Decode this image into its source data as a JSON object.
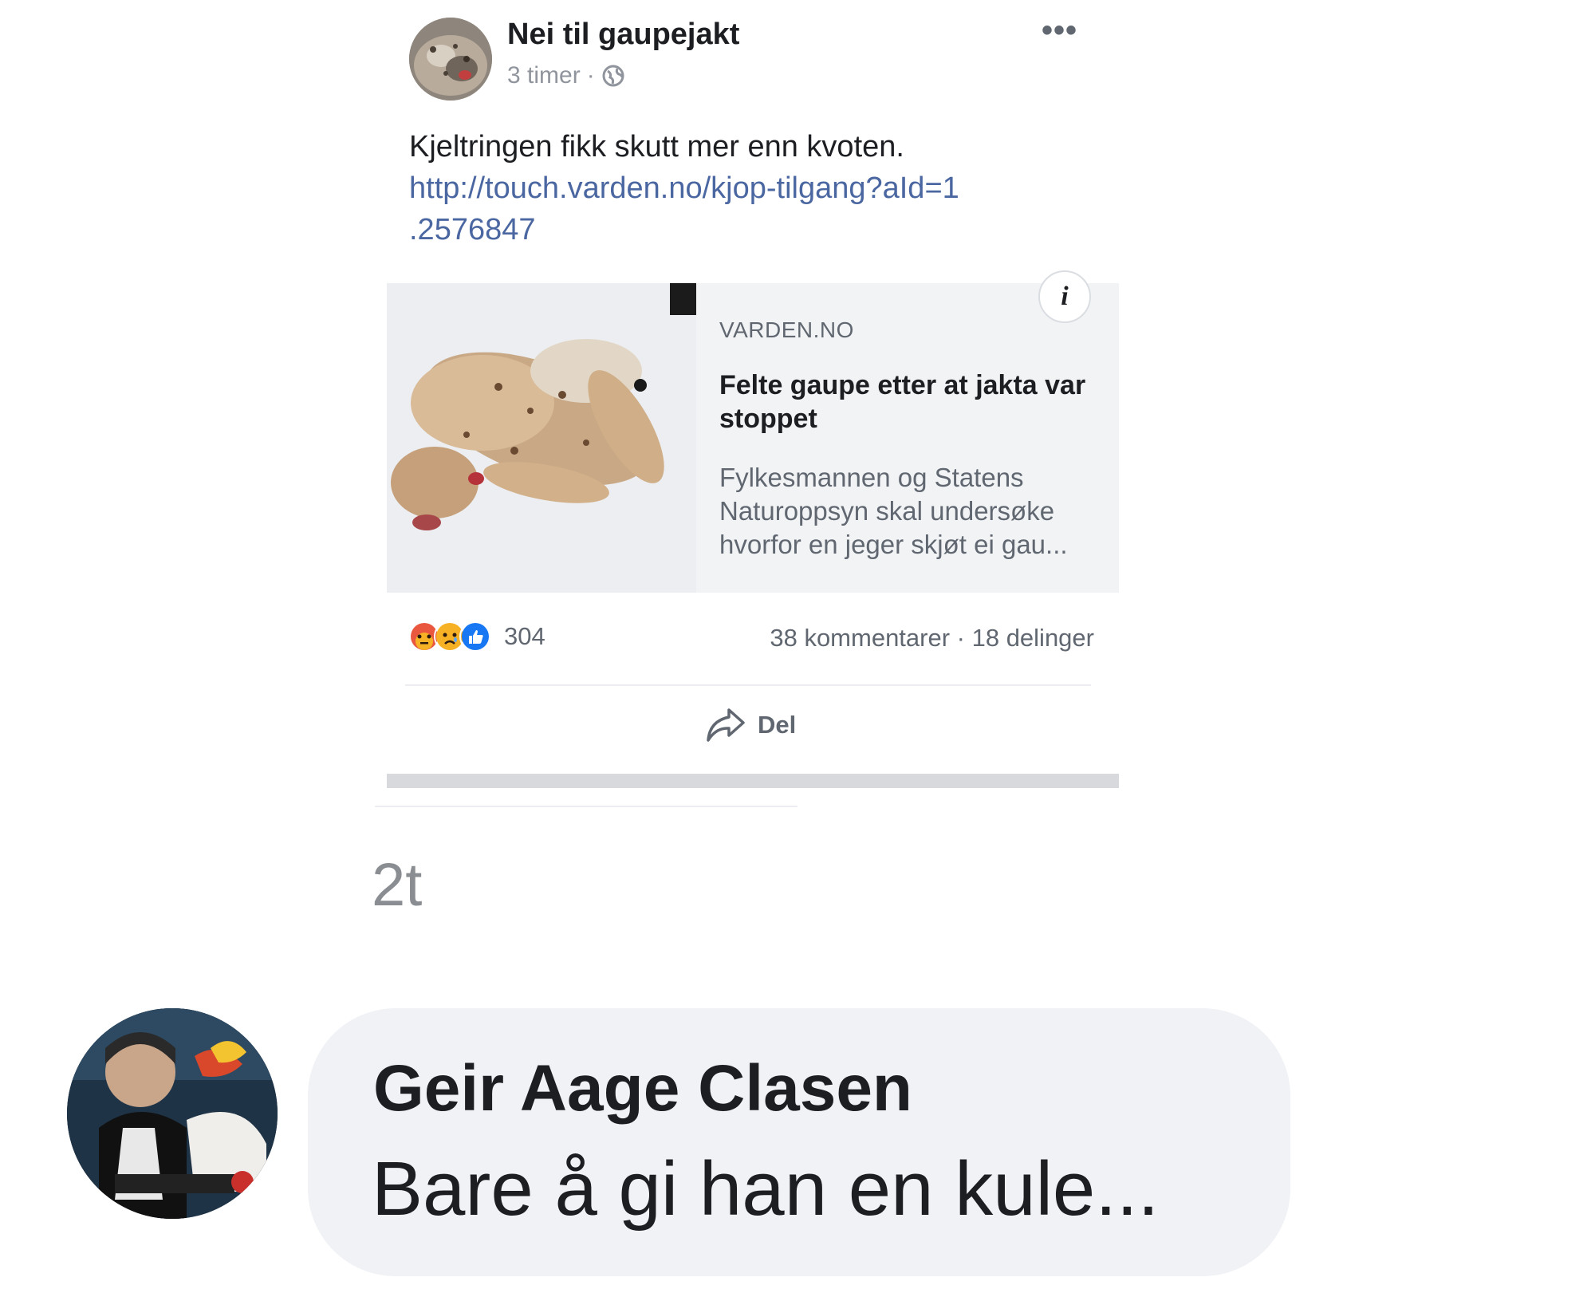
{
  "post": {
    "page_name": "Nei til gaupejakt",
    "time": "3 timer",
    "separator": "·",
    "more_icon": "•••",
    "text": "Kjeltringen fikk skutt mer enn kvoten.",
    "link_line1": "http://touch.varden.no/kjop-tilgang?aId=1",
    "link_line2": ".2576847"
  },
  "card": {
    "domain": "VARDEN.NO",
    "title": "Felte gaupe etter at jakta var stoppet",
    "description": "Fylkesmannen og Statens Naturoppsyn skal undersøke hvorfor en jeger skjøt ei gau...",
    "info_icon": "i"
  },
  "engagement": {
    "reaction_icons": [
      "angry-icon",
      "sad-icon",
      "like-icon"
    ],
    "reaction_count": "304",
    "comments_shares": "38 kommentarer · 18 delinger",
    "share_label": "Del"
  },
  "comment_time": "2t",
  "comment": {
    "author": "Geir Aage Clasen",
    "text": "Bare å gi han en kule..."
  },
  "colors": {
    "link": "#4b67a1",
    "secondary_text": "#606770",
    "card_bg": "#f2f3f5",
    "like_blue": "#1877f2",
    "angry_red": "#e9573f",
    "sad_yellow": "#f7b125"
  }
}
